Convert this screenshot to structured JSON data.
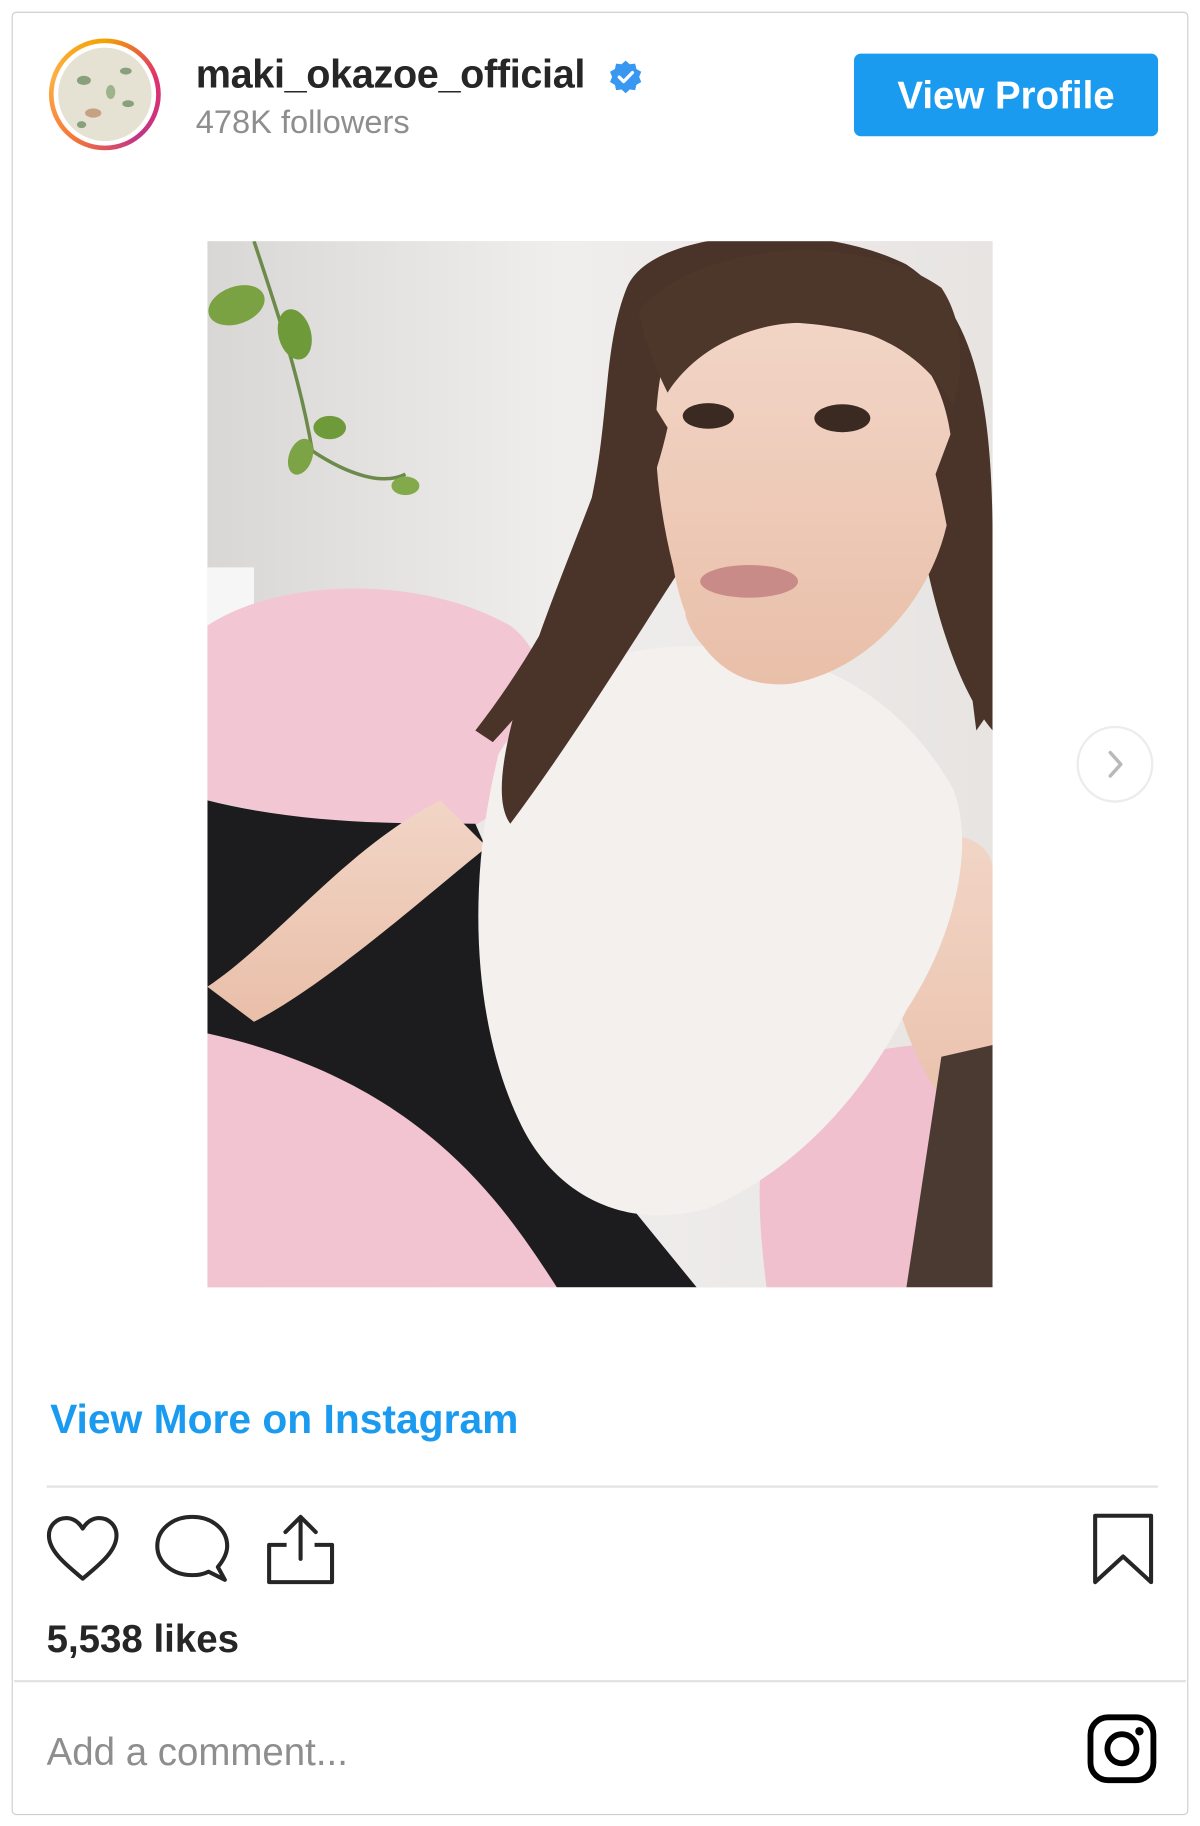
{
  "header": {
    "username": "maki_okazoe_official",
    "followers": "478K followers",
    "view_profile_label": "View Profile"
  },
  "post": {
    "view_more_label": "View More on Instagram",
    "likes": "5,538 likes",
    "comment_placeholder": "Add a comment..."
  },
  "icons": {
    "verified": "verified-badge-icon",
    "next": "chevron-right-icon",
    "like": "heart-icon",
    "comment": "comment-icon",
    "share": "share-icon",
    "save": "bookmark-icon",
    "instagram": "instagram-logo-icon"
  },
  "colors": {
    "accent": "#1a9bf0",
    "text": "#262626",
    "muted": "#8e8e8e"
  }
}
